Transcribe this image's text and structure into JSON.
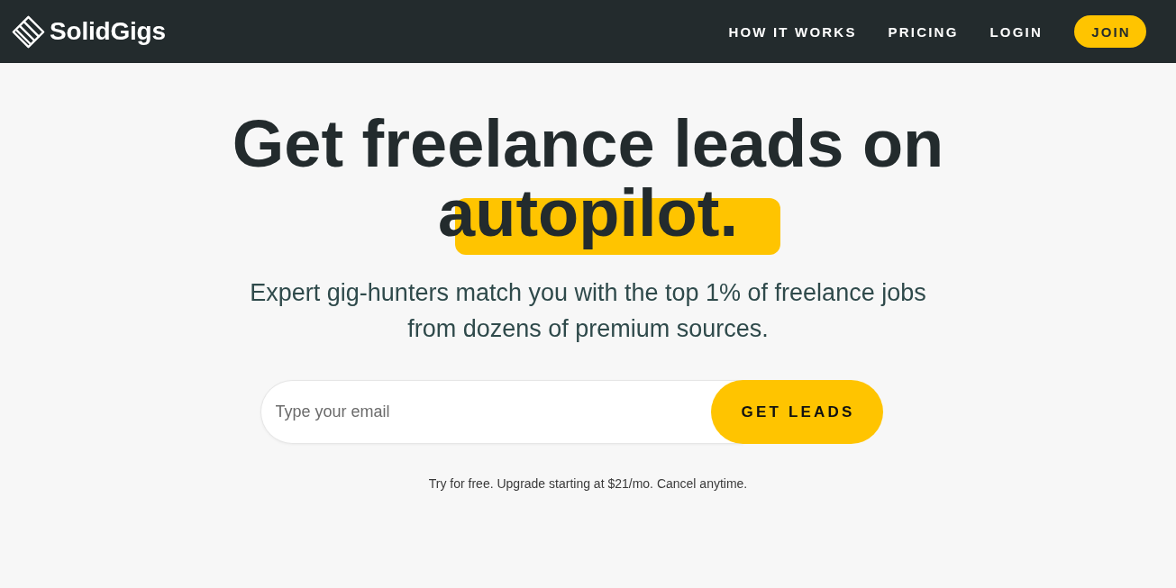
{
  "header": {
    "logo": "SolidGigs",
    "nav": [
      {
        "label": "HOW IT WORKS",
        "kind": "link"
      },
      {
        "label": "PRICING",
        "kind": "link"
      },
      {
        "label": "LOGIN",
        "kind": "link"
      },
      {
        "label": "JOIN",
        "kind": "button"
      }
    ]
  },
  "hero": {
    "heading": "Get freelance leads on",
    "highlight": "autopilot.",
    "subtitle": "Expert gig-hunters match you with the top 1% of freelance jobs from dozens of premium sources."
  },
  "signup": {
    "placeholder": "Type your email",
    "button": "GET LEADS",
    "note": "Try for free. Upgrade starting at $21/mo. Cancel anytime."
  }
}
